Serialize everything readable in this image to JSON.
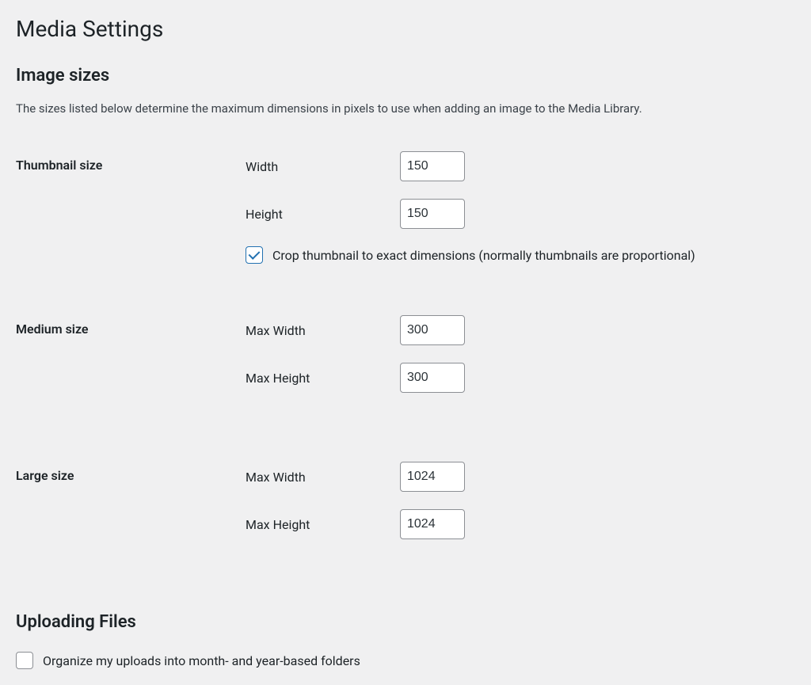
{
  "page": {
    "title": "Media Settings"
  },
  "image_sizes": {
    "heading": "Image sizes",
    "description": "The sizes listed below determine the maximum dimensions in pixels to use when adding an image to the Media Library.",
    "thumbnail": {
      "label": "Thumbnail size",
      "width_label": "Width",
      "width_value": "150",
      "height_label": "Height",
      "height_value": "150",
      "crop_label": "Crop thumbnail to exact dimensions (normally thumbnails are proportional)",
      "crop_checked": true
    },
    "medium": {
      "label": "Medium size",
      "max_width_label": "Max Width",
      "max_width_value": "300",
      "max_height_label": "Max Height",
      "max_height_value": "300"
    },
    "large": {
      "label": "Large size",
      "max_width_label": "Max Width",
      "max_width_value": "1024",
      "max_height_label": "Max Height",
      "max_height_value": "1024"
    }
  },
  "uploading_files": {
    "heading": "Uploading Files",
    "organize_label": "Organize my uploads into month- and year-based folders",
    "organize_checked": false
  }
}
